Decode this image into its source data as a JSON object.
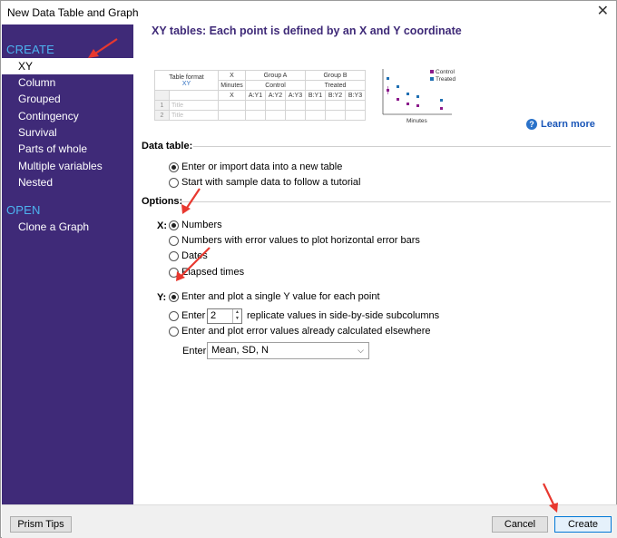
{
  "window": {
    "title": "New Data Table and Graph"
  },
  "sidebar": {
    "create_header": "CREATE",
    "items": [
      {
        "label": "XY",
        "selected": true
      },
      {
        "label": "Column"
      },
      {
        "label": "Grouped"
      },
      {
        "label": "Contingency"
      },
      {
        "label": "Survival"
      },
      {
        "label": "Parts of whole"
      },
      {
        "label": "Multiple variables"
      },
      {
        "label": "Nested"
      }
    ],
    "open_header": "OPEN",
    "open_items": [
      {
        "label": "Clone a Graph"
      }
    ]
  },
  "main": {
    "title": "XY tables: Each point is defined by an X and Y coordinate",
    "learn_more": "Learn more"
  },
  "preview_table": {
    "table_format_label": "Table format",
    "table_format_value": "XY",
    "x_header": "X",
    "group_a": "Group A",
    "group_b": "Group B",
    "x_title": "Minutes",
    "group_a_title": "Control",
    "group_b_title": "Treated",
    "subcolumns": [
      "X",
      "A:Y1",
      "A:Y2",
      "A:Y3",
      "B:Y1",
      "B:Y2",
      "B:Y3"
    ],
    "rows": [
      {
        "num": "1",
        "title": "Title"
      },
      {
        "num": "2",
        "title": "Title"
      }
    ]
  },
  "preview_chart": {
    "legend": [
      {
        "name": "Control",
        "color": "#8b1a8b"
      },
      {
        "name": "Treated",
        "color": "#1f6fb2"
      }
    ],
    "xlabel": "Minutes"
  },
  "data_table": {
    "label": "Data table:",
    "options": [
      {
        "label": "Enter or import data into a new table",
        "checked": true
      },
      {
        "label": "Start with sample data to follow a tutorial",
        "checked": false
      }
    ]
  },
  "options": {
    "label": "Options:",
    "x_label": "X:",
    "x_options": [
      {
        "label": "Numbers",
        "checked": true
      },
      {
        "label": "Numbers with error values to plot horizontal error bars",
        "checked": false
      },
      {
        "label": "Dates",
        "checked": false
      },
      {
        "label": "Elapsed times",
        "checked": false
      }
    ],
    "y_label": "Y:",
    "y_single": "Enter and plot a single Y value for each point",
    "y_replicate_prefix": "Enter",
    "y_replicate_value": "2",
    "y_replicate_suffix": "replicate values in side-by-side subcolumns",
    "y_error": "Enter and plot error values already calculated elsewhere",
    "enter_label": "Enter:",
    "enter_value": "Mean, SD, N"
  },
  "footer": {
    "tips": "Prism Tips",
    "cancel": "Cancel",
    "create": "Create"
  },
  "colors": {
    "sidebar_bg": "#3f2a78",
    "sidebar_header": "#4db3f0",
    "annotation_arrow": "#e8382f"
  }
}
